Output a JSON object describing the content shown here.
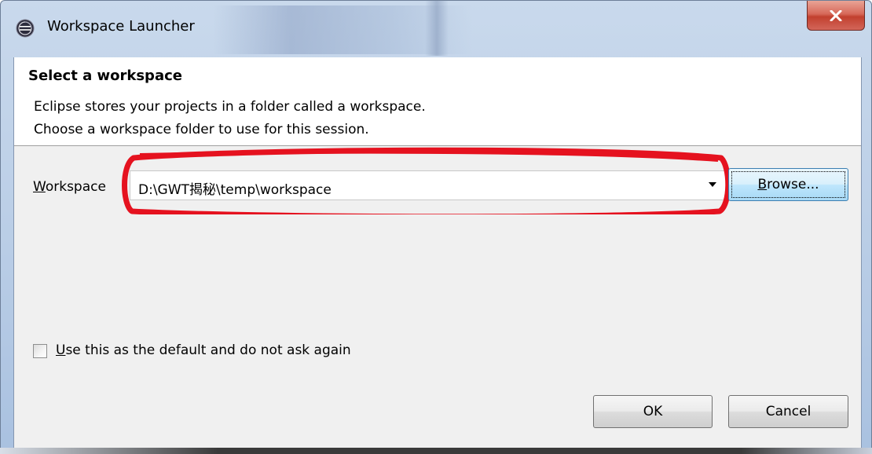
{
  "window": {
    "title": "Workspace Launcher",
    "icon": "eclipse-icon",
    "close_icon": "close-icon"
  },
  "banner": {
    "title": "Select a workspace",
    "description_line1": "Eclipse stores your projects in a folder called a workspace.",
    "description_line2": "Choose a workspace folder to use for this session."
  },
  "workspace": {
    "label_mnemonic": "W",
    "label_rest": "orkspace",
    "value": "D:\\GWT揭秘\\temp\\workspace",
    "dropdown_icon": "chevron-down-icon",
    "annotation_color": "#e5121f"
  },
  "browse_button": {
    "mnemonic": "B",
    "rest": "rowse..."
  },
  "default_option": {
    "checked": false,
    "mnemonic": "U",
    "rest": "se this as the default and do not ask again"
  },
  "buttons": {
    "ok": "OK",
    "cancel": "Cancel"
  }
}
